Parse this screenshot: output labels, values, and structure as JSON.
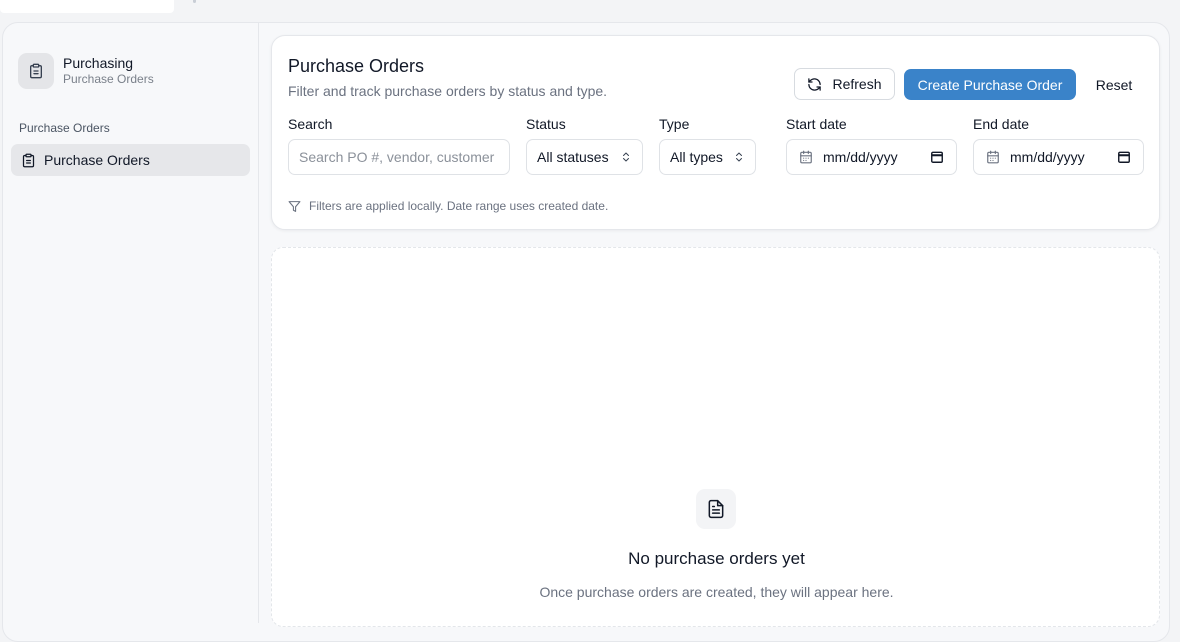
{
  "sidebar": {
    "brand_title": "Purchasing",
    "brand_subtitle": "Purchase Orders",
    "section_label": "Purchase Orders",
    "items": [
      {
        "label": "Purchase Orders",
        "icon": "clipboard-icon",
        "active": true
      }
    ]
  },
  "header": {
    "title": "Purchase Orders",
    "subtitle": "Filter and track purchase orders by status and type.",
    "refresh_label": "Refresh",
    "create_label": "Create Purchase Order",
    "reset_label": "Reset"
  },
  "filters": {
    "search_label": "Search",
    "search_placeholder": "Search PO #, vendor, customer",
    "search_value": "",
    "status_label": "Status",
    "status_value": "All statuses",
    "type_label": "Type",
    "type_value": "All types",
    "start_label": "Start date",
    "start_value": "mm/dd/yyyy",
    "end_label": "End date",
    "end_value": "mm/dd/yyyy",
    "hint": "Filters are applied locally. Date range uses created date."
  },
  "empty_state": {
    "title": "No purchase orders yet",
    "subtitle": "Once purchase orders are created, they will appear here."
  },
  "colors": {
    "accent": "#3a83c9",
    "sidebar_active": "#e6e7ea"
  }
}
